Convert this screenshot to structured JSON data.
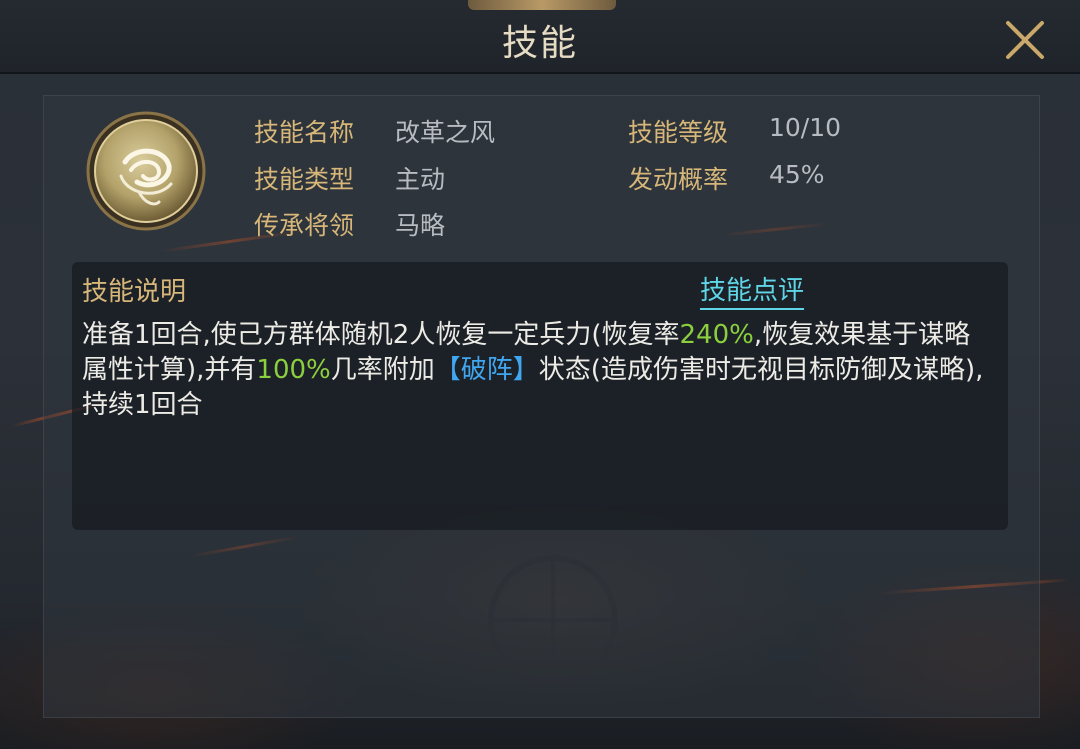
{
  "header": {
    "title": "技能"
  },
  "skill": {
    "icon": "whirlwind-icon",
    "name_label": "技能名称",
    "name_value": "改革之风",
    "level_label": "技能等级",
    "level_value": "10/10",
    "type_label": "技能类型",
    "type_value": "主动",
    "rate_label": "发动概率",
    "rate_value": "45%",
    "general_label": "传承将领",
    "general_value": "马略"
  },
  "description": {
    "title": "技能说明",
    "review_link": "技能点评",
    "seg1": "准备1回合,使己方群体随机2人恢复一定兵力(恢复率",
    "hl_rate": "240%",
    "seg2": ",恢复效果基于谋略属性计算),并有",
    "hl_chance": "100%",
    "seg3": "几率附加",
    "status": "【破阵】",
    "seg4": "状态(造成伤害时无视目标防御及谋略),持续1回合"
  },
  "colors": {
    "label_gold": "#d6b679",
    "value_grey": "#b8bcc2",
    "highlight_green": "#8ccf3e",
    "status_blue": "#3fa6ef",
    "link_cyan": "#5fd6e8"
  }
}
